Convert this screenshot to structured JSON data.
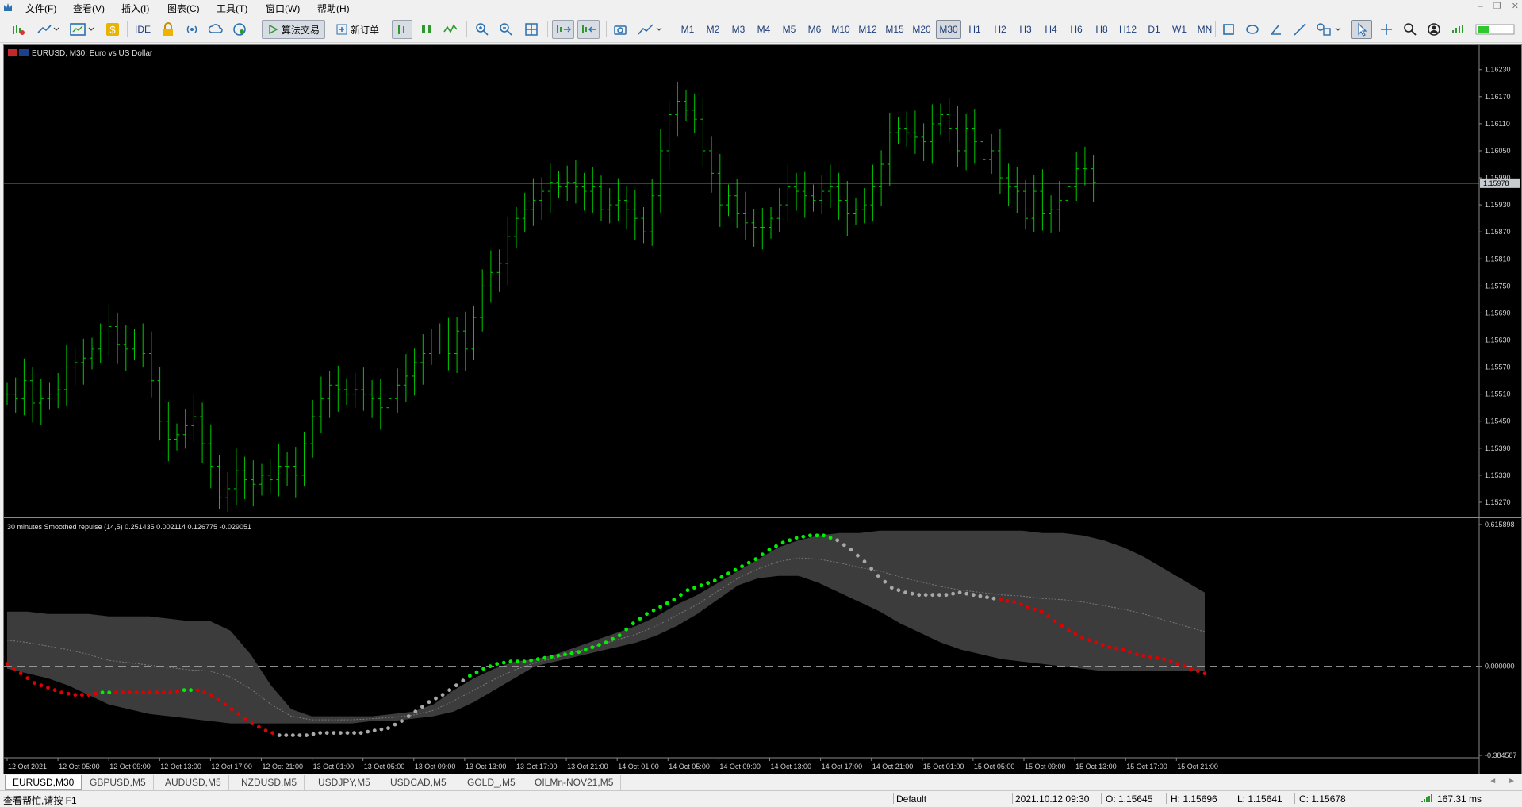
{
  "menu": [
    "文件(F)",
    "查看(V)",
    "插入(I)",
    "图表(C)",
    "工具(T)",
    "窗口(W)",
    "帮助(H)"
  ],
  "toolbar": {
    "ide_label": "IDE",
    "algo_trading_label": "算法交易",
    "new_order_label": "新订单",
    "timeframes": [
      "M1",
      "M2",
      "M3",
      "M4",
      "M5",
      "M6",
      "M10",
      "M12",
      "M15",
      "M20",
      "M30",
      "H1",
      "H2",
      "H3",
      "H4",
      "H6",
      "H8",
      "H12",
      "D1",
      "W1",
      "MN"
    ],
    "active_timeframe": "M30"
  },
  "chart": {
    "title": "EURUSD, M30:  Euro vs US Dollar",
    "current_price": "1.15978",
    "price_ticks": [
      "1.16230",
      "1.16170",
      "1.16110",
      "1.16050",
      "1.15990",
      "1.15930",
      "1.15870",
      "1.15810",
      "1.15750",
      "1.15690",
      "1.15630",
      "1.15570",
      "1.15510",
      "1.15450",
      "1.15390",
      "1.15330",
      "1.15270"
    ],
    "indicator": {
      "label": "30 minutes Smoothed repulse (14,5) 0.251435 0.002114 0.126775 -0.029051",
      "ticks": [
        "0.615898",
        "0.000000",
        "-0.384587"
      ]
    },
    "time_ticks": [
      "12 Oct 2021",
      "12 Oct 05:00",
      "12 Oct 09:00",
      "12 Oct 13:00",
      "12 Oct 17:00",
      "12 Oct 21:00",
      "13 Oct 01:00",
      "13 Oct 05:00",
      "13 Oct 09:00",
      "13 Oct 13:00",
      "13 Oct 17:00",
      "13 Oct 21:00",
      "14 Oct 01:00",
      "14 Oct 05:00",
      "14 Oct 09:00",
      "14 Oct 13:00",
      "14 Oct 17:00",
      "14 Oct 21:00",
      "15 Oct 01:00",
      "15 Oct 05:00",
      "15 Oct 09:00",
      "15 Oct 13:00",
      "15 Oct 17:00",
      "15 Oct 21:00"
    ],
    "colors": {
      "candle": "#00c800",
      "up_dot": "#00ee00",
      "down_dot": "#e00000",
      "neutral_dot": "#a8a8a8",
      "band": "#3c3c3c"
    }
  },
  "chart_data": {
    "type": "line",
    "main_series": {
      "name": "EURUSD, M30",
      "ylim": [
        1.1524,
        1.1627
      ],
      "close": [
        1.1551,
        1.155,
        1.1554,
        1.1549,
        1.155,
        1.1551,
        1.1552,
        1.1557,
        1.1558,
        1.1559,
        1.1561,
        1.1563,
        1.1566,
        1.1562,
        1.1561,
        1.1563,
        1.156,
        1.1554,
        1.1545,
        1.1541,
        1.1542,
        1.1544,
        1.1546,
        1.154,
        1.1535,
        1.1528,
        1.153,
        1.1534,
        1.1532,
        1.1531,
        1.1533,
        1.1532,
        1.1535,
        1.1535,
        1.1533,
        1.154,
        1.1546,
        1.155,
        1.1553,
        1.1552,
        1.1551,
        1.1552,
        1.1551,
        1.155,
        1.1548,
        1.155,
        1.1553,
        1.1555,
        1.1558,
        1.156,
        1.1563,
        1.1563,
        1.156,
        1.1565,
        1.1561,
        1.1568,
        1.1575,
        1.1578,
        1.158,
        1.1586,
        1.159,
        1.1592,
        1.1594,
        1.1596,
        1.1598,
        1.1597,
        1.1598,
        1.1597,
        1.1596,
        1.1597,
        1.1592,
        1.1593,
        1.1594,
        1.1592,
        1.159,
        1.1587,
        1.1595,
        1.1605,
        1.1613,
        1.1616,
        1.1614,
        1.1612,
        1.1605,
        1.16,
        1.1593,
        1.1595,
        1.1591,
        1.1589,
        1.1588,
        1.1588,
        1.159,
        1.1593,
        1.1597,
        1.1596,
        1.1595,
        1.1594,
        1.1596,
        1.1597,
        1.1594,
        1.1591,
        1.1592,
        1.1593,
        1.1597,
        1.1602,
        1.1609,
        1.161,
        1.1609,
        1.1608,
        1.1607,
        1.1611,
        1.1613,
        1.161,
        1.1605,
        1.161,
        1.1607,
        1.1603,
        1.1605,
        1.1599,
        1.1597,
        1.1596,
        1.159,
        1.1596,
        1.1591,
        1.1592,
        1.1594,
        1.1597,
        1.1601,
        1.1601,
        1.1598
      ]
    },
    "indicator_series": {
      "name": "30 minutes Smoothed repulse (14,5)",
      "ylim": [
        -0.384587,
        0.615898
      ],
      "values": [
        0.01,
        -0.03,
        -0.07,
        -0.09,
        -0.11,
        -0.12,
        -0.12,
        -0.11,
        -0.11,
        -0.11,
        -0.11,
        -0.11,
        -0.11,
        -0.1,
        -0.1,
        -0.12,
        -0.16,
        -0.2,
        -0.24,
        -0.27,
        -0.29,
        -0.29,
        -0.29,
        -0.28,
        -0.28,
        -0.28,
        -0.28,
        -0.27,
        -0.26,
        -0.23,
        -0.19,
        -0.15,
        -0.12,
        -0.08,
        -0.04,
        -0.01,
        0.01,
        0.02,
        0.02,
        0.03,
        0.04,
        0.05,
        0.06,
        0.08,
        0.1,
        0.13,
        0.18,
        0.22,
        0.25,
        0.28,
        0.32,
        0.34,
        0.36,
        0.39,
        0.42,
        0.45,
        0.49,
        0.52,
        0.54,
        0.55,
        0.55,
        0.53,
        0.49,
        0.44,
        0.38,
        0.33,
        0.31,
        0.3,
        0.3,
        0.3,
        0.31,
        0.3,
        0.29,
        0.28,
        0.27,
        0.25,
        0.23,
        0.19,
        0.15,
        0.12,
        0.1,
        0.08,
        0.07,
        0.05,
        0.04,
        0.03,
        0.01,
        -0.01,
        -0.03
      ],
      "band_upper": [
        0.23,
        0.23,
        0.22,
        0.22,
        0.22,
        0.21,
        0.21,
        0.21,
        0.2,
        0.19,
        0.19,
        0.15,
        0.05,
        -0.08,
        -0.18,
        -0.21,
        -0.21,
        -0.21,
        -0.21,
        -0.2,
        -0.19,
        -0.16,
        -0.1,
        -0.05,
        -0.01,
        0.02,
        0.03,
        0.05,
        0.08,
        0.11,
        0.14,
        0.17,
        0.21,
        0.26,
        0.3,
        0.35,
        0.4,
        0.45,
        0.5,
        0.53,
        0.55,
        0.56,
        0.56,
        0.57,
        0.57,
        0.57,
        0.57,
        0.57,
        0.57,
        0.57,
        0.57,
        0.56,
        0.56,
        0.55,
        0.53,
        0.5,
        0.46,
        0.41,
        0.36,
        0.31
      ],
      "band_lower": [
        -0.01,
        -0.03,
        -0.05,
        -0.08,
        -0.12,
        -0.16,
        -0.18,
        -0.2,
        -0.21,
        -0.22,
        -0.23,
        -0.24,
        -0.24,
        -0.24,
        -0.24,
        -0.24,
        -0.24,
        -0.24,
        -0.23,
        -0.23,
        -0.22,
        -0.21,
        -0.19,
        -0.15,
        -0.1,
        -0.05,
        0.0,
        0.02,
        0.04,
        0.06,
        0.08,
        0.1,
        0.13,
        0.17,
        0.22,
        0.28,
        0.34,
        0.37,
        0.38,
        0.38,
        0.35,
        0.31,
        0.27,
        0.23,
        0.18,
        0.14,
        0.1,
        0.07,
        0.05,
        0.03,
        0.02,
        0.01,
        0.0,
        -0.01,
        -0.02,
        -0.02,
        -0.02,
        -0.02,
        -0.02,
        -0.02
      ]
    }
  },
  "tabs": [
    "EURUSD,M30",
    "GBPUSD,M5",
    "AUDUSD,M5",
    "NZDUSD,M5",
    "USDJPY,M5",
    "USDCAD,M5",
    "GOLD_,M5",
    "OILMn-NOV21,M5"
  ],
  "status": {
    "help": "查看帮忙,请按 F1",
    "profile": "Default",
    "datetime": "2021.10.12 09:30",
    "open": "O: 1.15645",
    "high": "H: 1.15696",
    "low": "L: 1.15641",
    "close": "C: 1.15678",
    "latency": "167.31 ms"
  }
}
